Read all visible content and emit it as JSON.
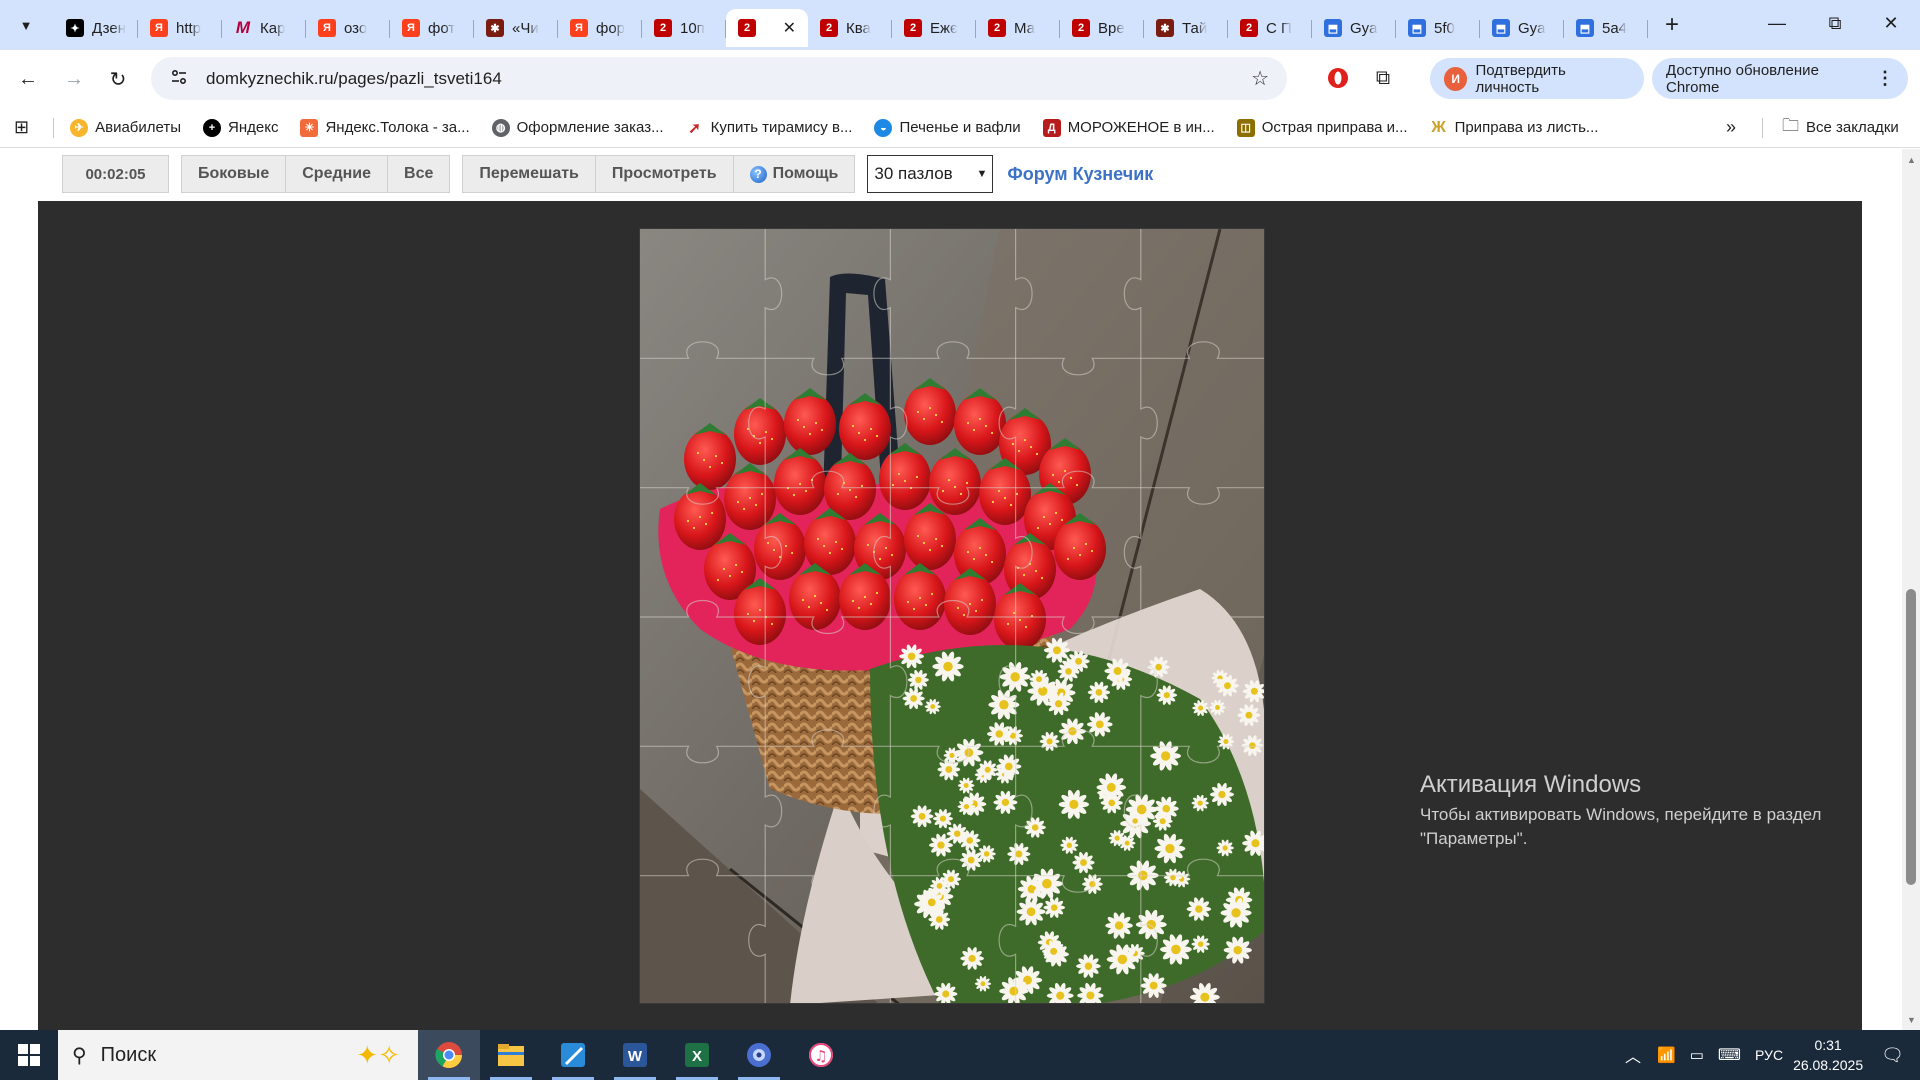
{
  "browser": {
    "tabs": [
      {
        "label": "Дзен",
        "favicon": "dzen-icon"
      },
      {
        "label": "http",
        "favicon": "yandex-icon"
      },
      {
        "label": "Кар",
        "favicon": "m-icon"
      },
      {
        "label": "озо",
        "favicon": "yandex-icon"
      },
      {
        "label": "фот",
        "favicon": "yandex-icon"
      },
      {
        "label": "«Чи",
        "favicon": "red-icon"
      },
      {
        "label": "фор",
        "favicon": "yandex-icon"
      },
      {
        "label": "10п",
        "favicon": "site2-icon"
      },
      {
        "label": "",
        "favicon": "site2-icon",
        "active": true
      },
      {
        "label": "Ква",
        "favicon": "site2-icon"
      },
      {
        "label": "Ежє",
        "favicon": "site2-icon"
      },
      {
        "label": "Ма",
        "favicon": "site2-icon"
      },
      {
        "label": "Вре",
        "favicon": "site2-icon"
      },
      {
        "label": "Тай",
        "favicon": "red-icon"
      },
      {
        "label": "С П",
        "favicon": "site2-icon"
      },
      {
        "label": "Gya",
        "favicon": "doc-icon"
      },
      {
        "label": "5f0",
        "favicon": "doc-icon"
      },
      {
        "label": "Gya",
        "favicon": "doc-icon"
      },
      {
        "label": "5a4",
        "favicon": "doc-icon"
      }
    ],
    "url": "domkyznechik.ru/pages/pazli_tsveti164",
    "profile_button": "Подтвердить личность",
    "profile_initial": "И",
    "update_button": "Доступно обновление Chrome",
    "bookmarks": [
      {
        "label": "Авиабилеты",
        "icon": "plane-icon",
        "color": "#f7b52c"
      },
      {
        "label": "Яндекс",
        "icon": "plus-icon",
        "color": "#000000"
      },
      {
        "label": "Яндекс.Толока - за...",
        "icon": "toloka-icon",
        "color": "#f26b3a"
      },
      {
        "label": "Оформление заказ...",
        "icon": "globe-icon",
        "color": "#5f6368"
      },
      {
        "label": "Купить тирамису в...",
        "icon": "rocket-icon",
        "color": "#c62828"
      },
      {
        "label": "Печенье и вафли",
        "icon": "cart-icon",
        "color": "#1e88e5"
      },
      {
        "label": "МОРОЖЕНОЕ в ин...",
        "icon": "d-icon",
        "color": "#b71c1c"
      },
      {
        "label": "Острая приправа и...",
        "icon": "wb-icon",
        "color": "#8d6e00"
      },
      {
        "label": "Приправа из листь...",
        "icon": "zh-icon",
        "color": "#c9a227"
      }
    ],
    "all_bookmarks": "Все закладки"
  },
  "puzzle_page": {
    "timer": "00:02:05",
    "buttons": {
      "side": "Боковые",
      "middle": "Средние",
      "all": "Все",
      "shuffle": "Перемешать",
      "preview": "Просмотреть",
      "help": "Помощь"
    },
    "piece_count": "30 пазлов",
    "forum_link": "Форум Кузнечик",
    "grid": {
      "columns": 5,
      "rows": 6
    }
  },
  "watermark": {
    "title": "Активация Windows",
    "line1": "Чтобы активировать Windows, перейдите в раздел",
    "line2": "\"Параметры\"."
  },
  "taskbar": {
    "search_placeholder": "Поиск",
    "tray": {
      "language": "РУС",
      "time": "0:31",
      "date": "26.08.2025"
    }
  }
}
